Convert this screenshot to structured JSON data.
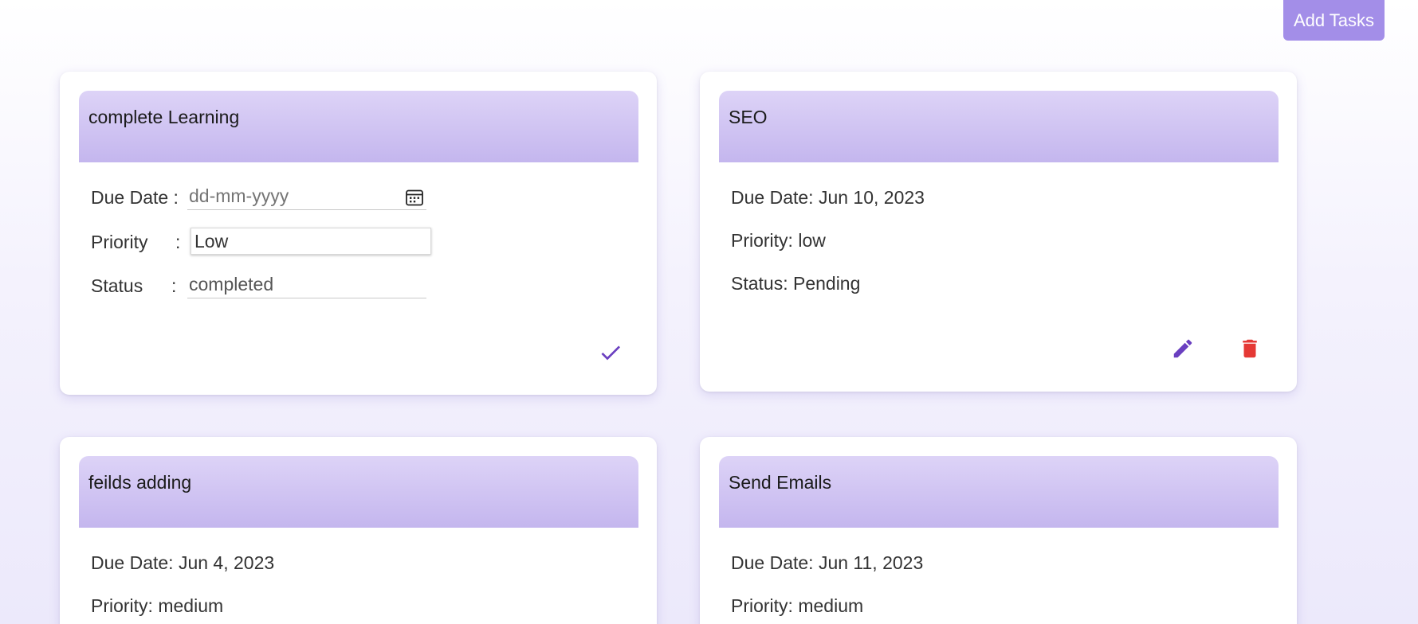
{
  "toolbar": {
    "add_label": "Add Tasks"
  },
  "colors": {
    "accent": "#a38ee8",
    "edit_icon": "#6a3fc0",
    "delete_icon": "#e53935",
    "header_top": "#ddd3f7",
    "header_bottom": "#c4b6ee"
  },
  "cards": [
    {
      "title": "complete Learning",
      "mode": "editing",
      "due_label": "Due Date :",
      "due_placeholder": "dd-mm-yyyy",
      "priority_label": "Priority",
      "priority_value": "Low",
      "status_label": "Status",
      "status_value": "completed",
      "colon": ":",
      "save_icon": "check-icon",
      "calendar_icon": "calendar-icon"
    },
    {
      "title": "SEO",
      "mode": "view",
      "due": "Due Date: Jun 10, 2023",
      "priority": "Priority: low",
      "status": "Status: Pending",
      "edit_icon": "pencil-icon",
      "delete_icon": "trash-icon"
    },
    {
      "title": "feilds adding",
      "mode": "view",
      "due": "Due Date: Jun 4, 2023",
      "priority": "Priority: medium"
    },
    {
      "title": "Send Emails",
      "mode": "view",
      "due": "Due Date: Jun 11, 2023",
      "priority": "Priority: medium"
    }
  ]
}
